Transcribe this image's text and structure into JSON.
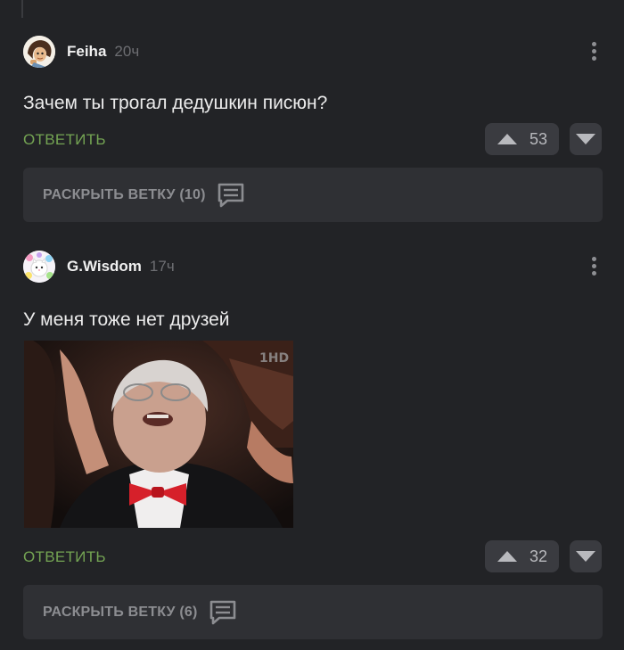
{
  "comments": [
    {
      "author": "Feiha",
      "time": "20ч",
      "text": "Зачем ты трогал дедушкин писюн?",
      "reply_label": "ОТВЕТИТЬ",
      "votes": "53",
      "expand_label": "РАСКРЫТЬ ВЕТКУ (10)"
    },
    {
      "author": "G.Wisdom",
      "time": "17ч",
      "text": "У меня тоже нет друзей",
      "reply_label": "ОТВЕТИТЬ",
      "votes": "32",
      "expand_label": "РАСКРЫТЬ ВЕТКУ (6)",
      "image_watermark": "1HD"
    }
  ],
  "colors": {
    "background": "#222326",
    "reply": "#74a453",
    "panel": "#2f3034",
    "vote_bg": "#3a3b40"
  },
  "icons": [
    "more-vertical-icon",
    "arrow-up-icon",
    "arrow-down-icon",
    "comment-icon"
  ]
}
